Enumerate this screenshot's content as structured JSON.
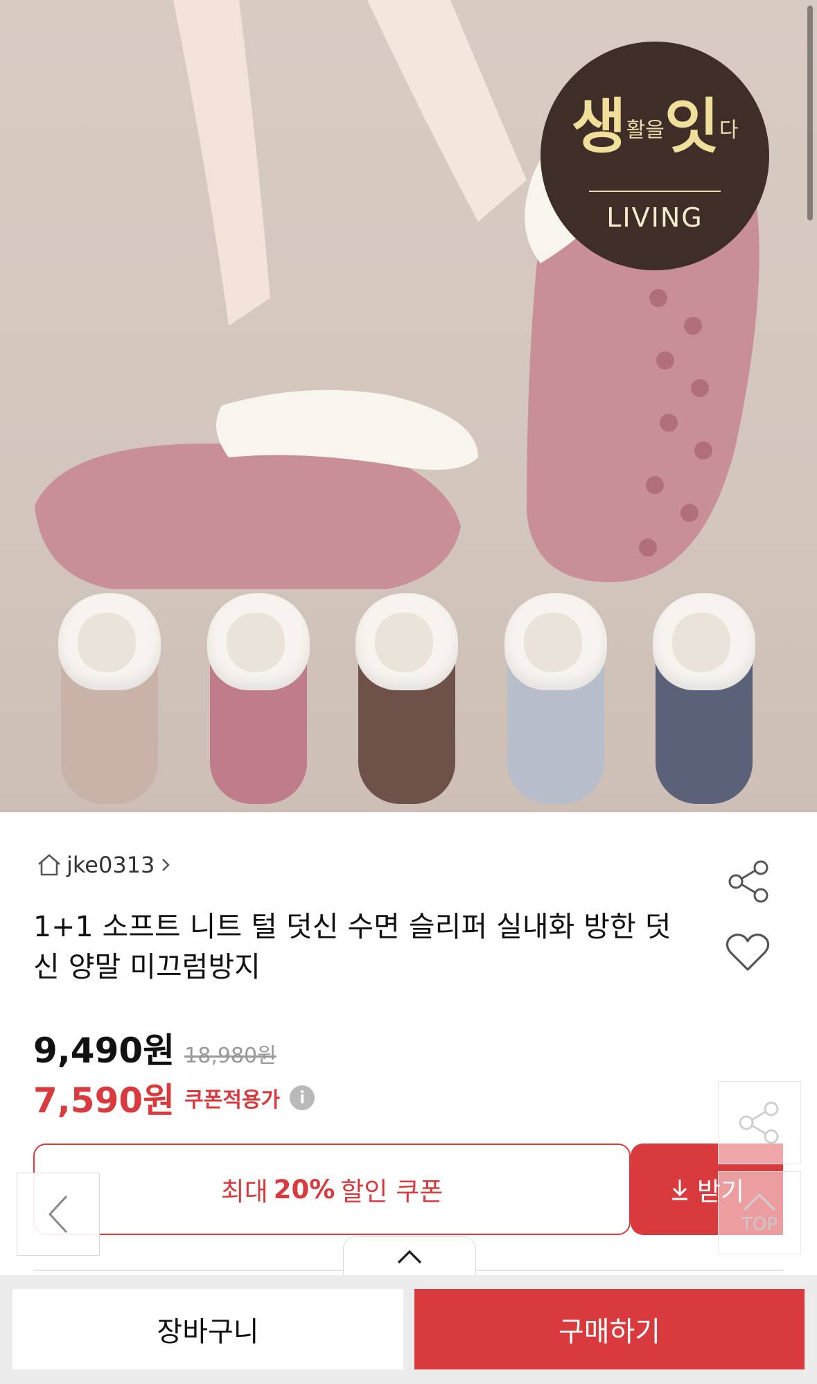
{
  "brand_badge": {
    "main_left": "생",
    "main_small": "활을",
    "main_right": "잇",
    "main_tail": "다",
    "sub": "LIVING"
  },
  "store": {
    "name": "jke0313",
    "home_icon": "home-icon",
    "chevron_icon": "chevron-right-icon"
  },
  "product": {
    "title": "1+1 소프트 니트 털 덧신 수면 슬리퍼 실내화 방한 덧신 양말 미끄럼방지",
    "price": "9,490원",
    "original_price": "18,980원",
    "coupon_price": "7,590원",
    "coupon_price_label": "쿠폰적용가",
    "info_icon": "i"
  },
  "coupon": {
    "text_before": "최대",
    "percent": "20%",
    "text_after": "할인 쿠폰",
    "button_label": "받기"
  },
  "floating": {
    "top_label": "TOP"
  },
  "bottom_bar": {
    "cart_label": "장바구니",
    "buy_label": "구매하기"
  },
  "colors": {
    "accent": "#d93a3e",
    "badge_bg": "#3f2e28",
    "sock_colors": [
      "#c9b3a8",
      "#bf7d8b",
      "#6e5249",
      "#b8bdcc",
      "#5a6178"
    ]
  }
}
